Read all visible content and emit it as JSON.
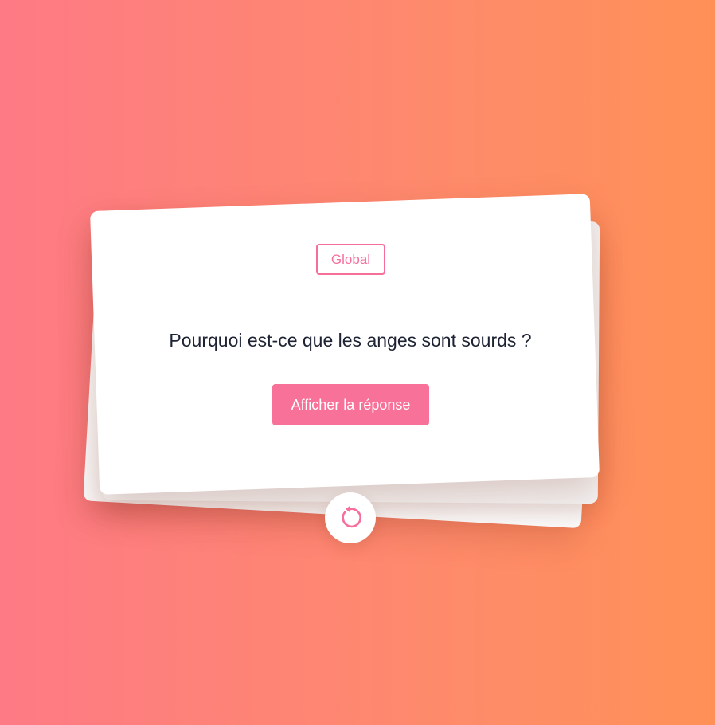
{
  "card": {
    "category": "Global",
    "question": "Pourquoi est-ce que les anges sont sourds ?",
    "reveal_label": "Afficher la réponse"
  },
  "controls": {
    "reset_icon": "rotate-ccw-icon"
  },
  "colors": {
    "accent": "#f77199",
    "background_start": "#fe7a85",
    "background_end": "#ff9157",
    "text": "#1d2333"
  }
}
